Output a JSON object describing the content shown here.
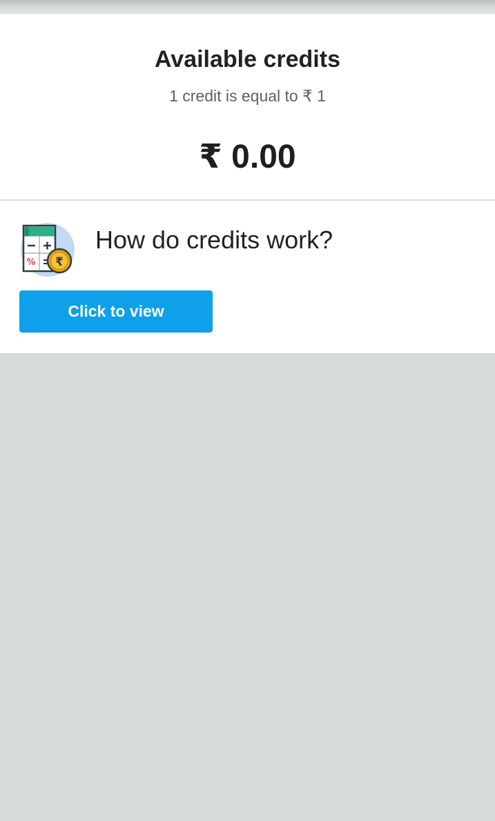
{
  "credits": {
    "title": "Available credits",
    "subtitle": "1 credit is equal to ₹ 1",
    "amount": "₹ 0.00"
  },
  "info": {
    "heading": "How do credits work?",
    "icon": "calculator-rupee-icon",
    "button_label": "Click to view"
  },
  "colors": {
    "accent": "#0ea0e8",
    "background": "#d6dbdb",
    "card": "#ffffff",
    "text_primary": "#222222",
    "text_secondary": "#5f5f5f"
  }
}
